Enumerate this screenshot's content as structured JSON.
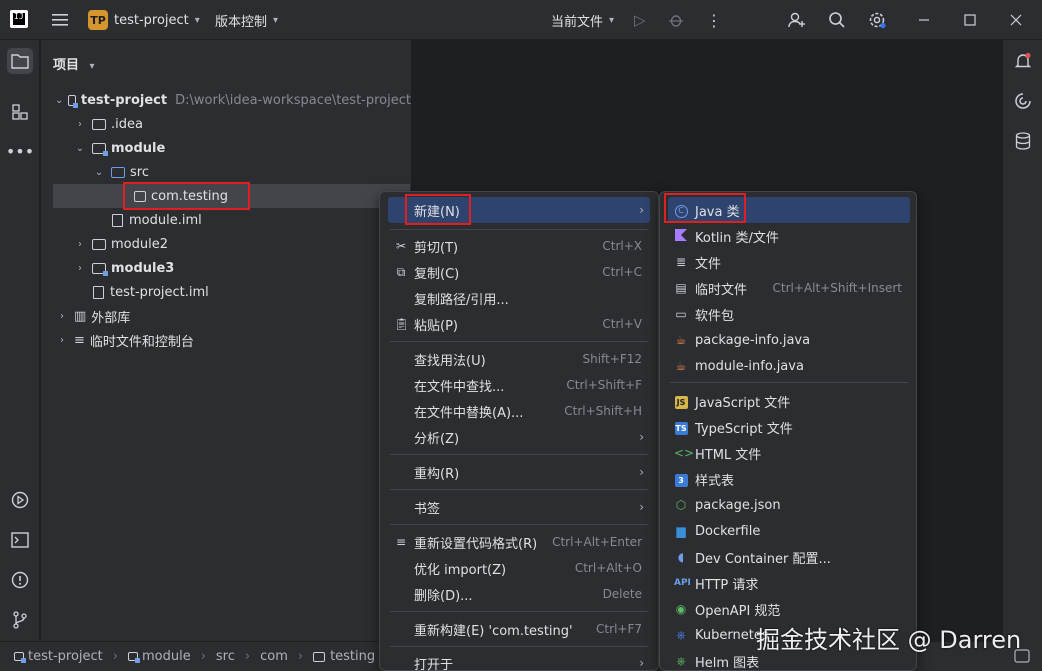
{
  "app": {
    "logo_text": "IJ",
    "project_badge": "TP",
    "project_name": "test-project",
    "vcs_label": "版本控制",
    "run_config": "当前文件"
  },
  "project_panel": {
    "title": "项目",
    "tree": [
      {
        "label": "test-project",
        "path": "D:\\work\\idea-workspace\\test-project"
      },
      {
        "label": ".idea"
      },
      {
        "label": "module"
      },
      {
        "label": "src"
      },
      {
        "label": "com.testing"
      },
      {
        "label": "module.iml"
      },
      {
        "label": "module2"
      },
      {
        "label": "module3"
      },
      {
        "label": "test-project.iml"
      },
      {
        "label": "外部库"
      },
      {
        "label": "临时文件和控制台"
      }
    ]
  },
  "context_menu": {
    "items": [
      {
        "label": "新建(N)",
        "shortcut": ""
      },
      {
        "label": "剪切(T)",
        "shortcut": "Ctrl+X"
      },
      {
        "label": "复制(C)",
        "shortcut": "Ctrl+C"
      },
      {
        "label": "复制路径/引用...",
        "shortcut": ""
      },
      {
        "label": "粘贴(P)",
        "shortcut": "Ctrl+V"
      },
      {
        "label": "查找用法(U)",
        "shortcut": "Shift+F12"
      },
      {
        "label": "在文件中查找...",
        "shortcut": "Ctrl+Shift+F"
      },
      {
        "label": "在文件中替换(A)...",
        "shortcut": "Ctrl+Shift+H"
      },
      {
        "label": "分析(Z)",
        "shortcut": ""
      },
      {
        "label": "重构(R)",
        "shortcut": ""
      },
      {
        "label": "书签",
        "shortcut": ""
      },
      {
        "label": "重新设置代码格式(R)",
        "shortcut": "Ctrl+Alt+Enter"
      },
      {
        "label": "优化 import(Z)",
        "shortcut": "Ctrl+Alt+O"
      },
      {
        "label": "删除(D)...",
        "shortcut": "Delete"
      },
      {
        "label": "重新构建(E) 'com.testing'",
        "shortcut": "Ctrl+F7"
      },
      {
        "label": "打开于",
        "shortcut": ""
      }
    ]
  },
  "new_submenu": {
    "items": [
      {
        "label": "Java 类",
        "icon": "java-class-icon"
      },
      {
        "label": "Kotlin 类/文件",
        "icon": "kotlin-icon"
      },
      {
        "label": "文件",
        "icon": "file-icon"
      },
      {
        "label": "临时文件",
        "icon": "scratch-file-icon",
        "shortcut": "Ctrl+Alt+Shift+Insert"
      },
      {
        "label": "软件包",
        "icon": "package-icon"
      },
      {
        "label": "package-info.java",
        "icon": "java-cup-icon"
      },
      {
        "label": "module-info.java",
        "icon": "java-cup-icon"
      },
      {
        "label": "JavaScript 文件",
        "icon": "js-icon"
      },
      {
        "label": "TypeScript 文件",
        "icon": "ts-icon"
      },
      {
        "label": "HTML 文件",
        "icon": "html-icon"
      },
      {
        "label": "样式表",
        "icon": "css-icon"
      },
      {
        "label": "package.json",
        "icon": "nodejs-icon"
      },
      {
        "label": "Dockerfile",
        "icon": "docker-icon"
      },
      {
        "label": "Dev Container 配置...",
        "icon": "devcontainer-icon"
      },
      {
        "label": "HTTP 请求",
        "icon": "api-icon"
      },
      {
        "label": "OpenAPI 规范",
        "icon": "openapi-icon"
      },
      {
        "label": "Kubernetes",
        "icon": "kubernetes-icon"
      },
      {
        "label": "Helm 图表",
        "icon": "helm-icon"
      }
    ]
  },
  "statusbar": {
    "crumbs": [
      "test-project",
      "module",
      "src",
      "com",
      "testing"
    ]
  },
  "watermark": "掘金技术社区 @ Darren"
}
